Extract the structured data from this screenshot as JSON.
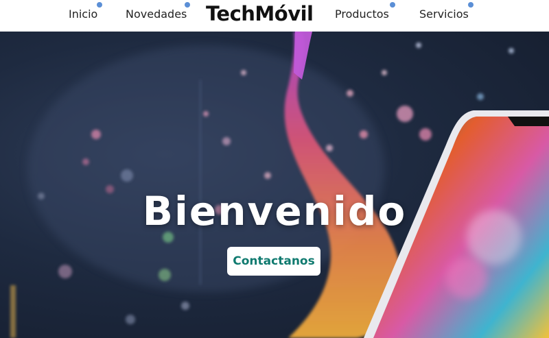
{
  "nav": {
    "brand": "TechMóvil",
    "items": [
      {
        "label": "Inicio"
      },
      {
        "label": "Novedades"
      },
      {
        "label": "Productos"
      },
      {
        "label": "Servicios"
      }
    ]
  },
  "hero": {
    "title": "Bienvenido",
    "cta_label": "Contactanos"
  },
  "colors": {
    "nav_dot": "#5b8fd6",
    "cta_text": "#0f7a6f",
    "hero_bg": "#1e2a40"
  }
}
